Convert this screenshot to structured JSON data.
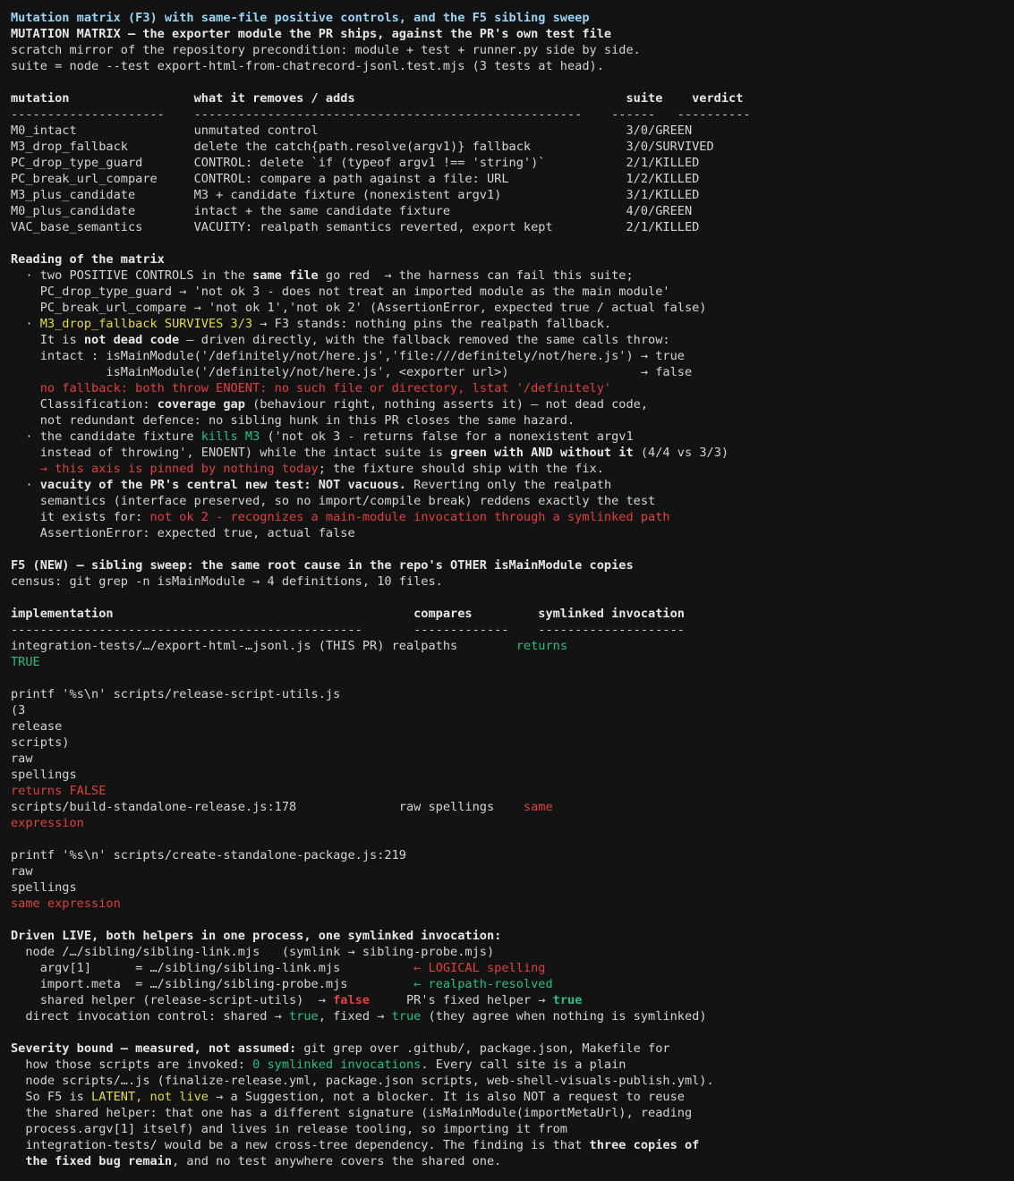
{
  "terminal": {
    "lines": [
      [
        {
          "t": "Mutation matrix (F3) with same-file positive controls, and the F5 sibling sweep",
          "s": "blue"
        }
      ],
      [
        {
          "t": "MUTATION MATRIX — the exporter module the PR ships, against the PR's own test file",
          "s": "b"
        }
      ],
      [
        {
          "t": "scratch mirror of the repository precondition: module + test + runner.py side by side."
        }
      ],
      [
        {
          "t": "suite = node --test export-html-from-chatrecord-jsonl.test.mjs (3 tests at head)."
        }
      ],
      [],
      [
        {
          "t": "mutation                 what it removes / adds                                     suite    verdict",
          "s": "b"
        }
      ],
      [
        {
          "t": "---------------------    -----------------------------------------------------    ------   ----------"
        }
      ],
      [
        {
          "t": "M0_intact                unmutated control                                          3/0/GREEN"
        }
      ],
      [
        {
          "t": "M3_drop_fallback         delete the catch{path.resolve(argv1)} fallback             3/0/SURVIVED"
        }
      ],
      [
        {
          "t": "PC_drop_type_guard       CONTROL: delete `if (typeof argv1 !== 'string')`           2/1/KILLED"
        }
      ],
      [
        {
          "t": "PC_break_url_compare     CONTROL: compare a path against a file: URL                1/2/KILLED"
        }
      ],
      [
        {
          "t": "M3_plus_candidate        M3 + candidate fixture (nonexistent argv1)                 3/1/KILLED"
        }
      ],
      [
        {
          "t": "M0_plus_candidate        intact + the same candidate fixture                        4/0/GREEN"
        }
      ],
      [
        {
          "t": "VAC_base_semantics       VACUITY: realpath semantics reverted, export kept          2/1/KILLED"
        }
      ],
      [],
      [
        {
          "t": "Reading of the matrix",
          "s": "b"
        }
      ],
      [
        {
          "t": "  · two POSITIVE CONTROLS in the "
        },
        {
          "t": "same file",
          "s": "b"
        },
        {
          "t": " go red  → the harness can fail this suite;"
        }
      ],
      [
        {
          "t": "    PC_drop_type_guard → 'not ok 3 - does not treat an imported module as the main module'"
        }
      ],
      [
        {
          "t": "    PC_break_url_compare → 'not ok 1','not ok 2' (AssertionError, expected true / actual false)"
        }
      ],
      [
        {
          "t": "  · "
        },
        {
          "t": "M3_drop_fallback SURVIVES 3/3",
          "s": "y"
        },
        {
          "t": " → F3 stands: nothing pins the realpath fallback."
        }
      ],
      [
        {
          "t": "    It is "
        },
        {
          "t": "not dead code",
          "s": "b"
        },
        {
          "t": " — driven directly, with the fallback removed the same calls throw:"
        }
      ],
      [
        {
          "t": "    intact : isMainModule('/definitely/not/here.js','file:///definitely/not/here.js') → true"
        }
      ],
      [
        {
          "t": "             isMainModule('/definitely/not/here.js', <exporter url>)                  → false"
        }
      ],
      [
        {
          "t": "    no fallback: both throw ENOENT: no such file or directory, lstat '/definitely'",
          "s": "r"
        }
      ],
      [
        {
          "t": "    Classification: "
        },
        {
          "t": "coverage gap",
          "s": "b"
        },
        {
          "t": " (behaviour right, nothing asserts it) — not dead code,"
        }
      ],
      [
        {
          "t": "    not redundant defence: no sibling hunk in this PR closes the same hazard."
        }
      ],
      [
        {
          "t": "  · the candidate fixture "
        },
        {
          "t": "kills M3",
          "s": "g"
        },
        {
          "t": " ('not ok 3 - returns false for a nonexistent argv1"
        }
      ],
      [
        {
          "t": "    instead of throwing', ENOENT) while the intact suite is "
        },
        {
          "t": "green with AND without it",
          "s": "b"
        },
        {
          "t": " (4/4 vs 3/3)"
        }
      ],
      [
        {
          "t": "    → this axis is pinned by nothing today",
          "s": "r"
        },
        {
          "t": "; the fixture should ship with the fix."
        }
      ],
      [
        {
          "t": "  · "
        },
        {
          "t": "vacuity of the PR's central new test: NOT vacuous.",
          "s": "b"
        },
        {
          "t": " Reverting only the realpath"
        }
      ],
      [
        {
          "t": "    semantics (interface preserved, so no import/compile break) reddens exactly the test"
        }
      ],
      [
        {
          "t": "    it exists for: "
        },
        {
          "t": "not ok 2 - recognizes a main-module invocation through a symlinked path",
          "s": "r"
        }
      ],
      [
        {
          "t": "    AssertionError: expected true, actual false"
        }
      ],
      [],
      [
        {
          "t": "F5 (NEW) — sibling sweep: the same root cause in the repo's OTHER isMainModule copies",
          "s": "b"
        }
      ],
      [
        {
          "t": "census: git grep -n isMainModule → 4 definitions, 10 files."
        }
      ],
      [],
      [
        {
          "t": "implementation                                         compares         symlinked invocation",
          "s": "b"
        }
      ],
      [
        {
          "t": "------------------------------------------------       -------------    --------------------"
        }
      ],
      [
        {
          "t": "integration-tests/…/export-html-…jsonl.js (THIS PR) realpaths        "
        },
        {
          "t": "returns",
          "s": "g"
        }
      ],
      [
        {
          "t": "TRUE",
          "s": "g"
        }
      ],
      [],
      [
        {
          "t": "printf '%s\\n' scripts/release-script-utils.js"
        }
      ],
      [
        {
          "t": "(3"
        }
      ],
      [
        {
          "t": "release"
        }
      ],
      [
        {
          "t": "scripts)"
        }
      ],
      [
        {
          "t": "raw"
        }
      ],
      [
        {
          "t": "spellings"
        }
      ],
      [
        {
          "t": "returns FALSE",
          "s": "r"
        }
      ],
      [
        {
          "t": "scripts/build-standalone-release.js:178              raw spellings    "
        },
        {
          "t": "same",
          "s": "r"
        }
      ],
      [
        {
          "t": "expression",
          "s": "r"
        }
      ],
      [],
      [
        {
          "t": "printf '%s\\n' scripts/create-standalone-package.js:219"
        }
      ],
      [
        {
          "t": "raw"
        }
      ],
      [
        {
          "t": "spellings"
        }
      ],
      [
        {
          "t": "same expression",
          "s": "r"
        }
      ],
      [],
      [
        {
          "t": "Driven LIVE, both helpers in one process, one symlinked invocation:",
          "s": "b"
        }
      ],
      [
        {
          "t": "  node /…/sibling/sibling-link.mjs   (symlink → sibling-probe.mjs)"
        }
      ],
      [
        {
          "t": "    argv[1]      = …/sibling/sibling-link.mjs          "
        },
        {
          "t": "← LOGICAL spelling",
          "s": "r"
        }
      ],
      [
        {
          "t": "    import.meta  = …/sibling/sibling-probe.mjs         "
        },
        {
          "t": "← realpath-resolved",
          "s": "g"
        }
      ],
      [
        {
          "t": "    shared helper (release-script-utils)  → "
        },
        {
          "t": "false",
          "s": "rb"
        },
        {
          "t": "     PR's fixed helper → "
        },
        {
          "t": "true",
          "s": "gb"
        }
      ],
      [
        {
          "t": "  direct invocation control: shared → "
        },
        {
          "t": "true",
          "s": "g"
        },
        {
          "t": ", fixed → "
        },
        {
          "t": "true",
          "s": "g"
        },
        {
          "t": " (they agree when nothing is symlinked)"
        }
      ],
      [],
      [
        {
          "t": "Severity bound — measured, not assumed:",
          "s": "b"
        },
        {
          "t": " git grep over .github/, package.json, Makefile for"
        }
      ],
      [
        {
          "t": "  how those scripts are invoked: "
        },
        {
          "t": "0 symlinked invocations",
          "s": "g"
        },
        {
          "t": ". Every call site is a plain"
        }
      ],
      [
        {
          "t": "  node scripts/….js (finalize-release.yml, package.json scripts, web-shell-visuals-publish.yml)."
        }
      ],
      [
        {
          "t": "  So F5 is "
        },
        {
          "t": "LATENT, not live",
          "s": "y"
        },
        {
          "t": " → a Suggestion, not a blocker. It is also NOT a request to reuse"
        }
      ],
      [
        {
          "t": "  the shared helper: that one has a different signature (isMainModule(importMetaUrl), reading"
        }
      ],
      [
        {
          "t": "  process.argv[1] itself) and lives in release tooling, so importing it from"
        }
      ],
      [
        {
          "t": "  integration-tests/ would be a new cross-tree dependency. The finding is that "
        },
        {
          "t": "three copies of",
          "s": "b"
        }
      ],
      [
        {
          "t": "  the fixed bug remain",
          "s": "b"
        },
        {
          "t": ", and no test anywhere covers the shared one."
        }
      ]
    ]
  }
}
